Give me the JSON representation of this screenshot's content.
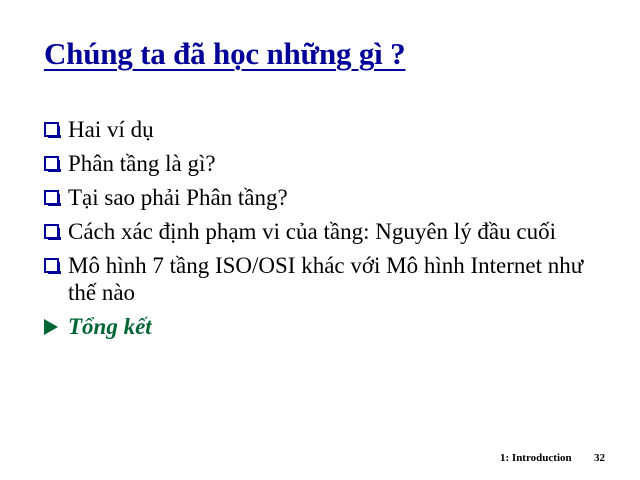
{
  "slide": {
    "title": "Chúng ta đã học những gì ?",
    "bullets": [
      {
        "text": "Hai ví dụ",
        "marker": "box-bullet-icon",
        "current": false
      },
      {
        "text": "Phân tầng là gì?",
        "marker": "box-bullet-icon",
        "current": false
      },
      {
        "text": "Tại sao phải Phân tầng?",
        "marker": "box-bullet-icon",
        "current": false
      },
      {
        "text": "Cách xác định phạm vi của tầng: Nguyên lý đầu cuối",
        "marker": "box-bullet-icon",
        "current": false
      },
      {
        "text": "Mô hình 7 tầng ISO/OSI khác với Mô hình Internet như thế nào",
        "marker": "box-bullet-icon",
        "current": false
      },
      {
        "text": "Tổng kết",
        "marker": "arrow-bullet-icon",
        "current": true
      }
    ],
    "footer": {
      "chapter": "1: Introduction",
      "page": "32"
    }
  },
  "colors": {
    "title": "#000099",
    "box_bullet": "#000099",
    "current_item": "#006633",
    "text": "#000000",
    "background": "#ffffff"
  }
}
